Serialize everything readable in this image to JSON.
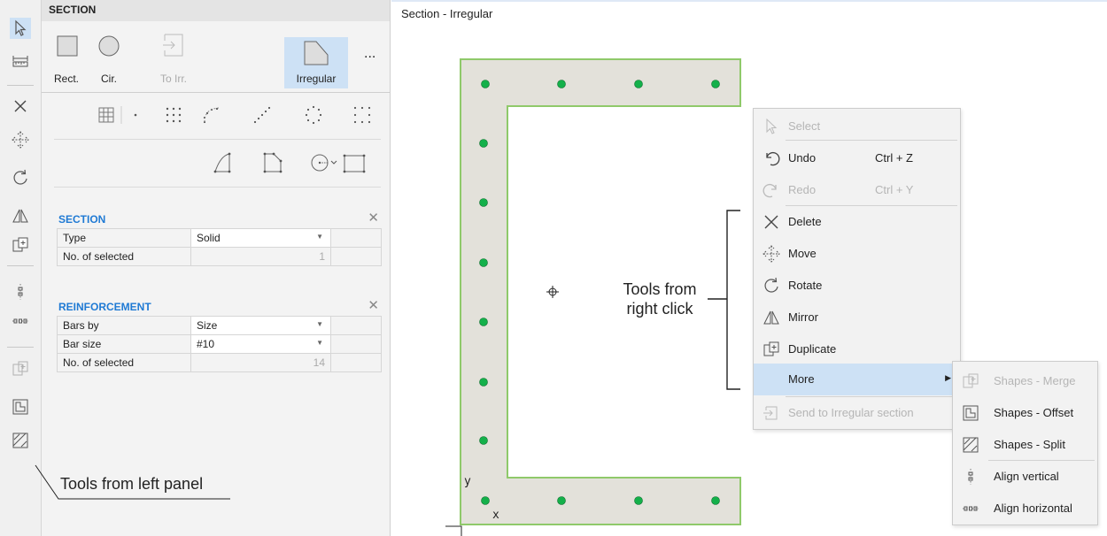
{
  "panel": {
    "title": "SECTION",
    "shape_buttons": [
      "Rect.",
      "Cir.",
      "To Irr.",
      "Irregular"
    ],
    "more_label": "...",
    "section": {
      "heading": "SECTION",
      "rows": [
        {
          "label": "Type",
          "value": "Solid"
        },
        {
          "label": "No. of selected",
          "value": "1"
        }
      ]
    },
    "reinforcement": {
      "heading": "REINFORCEMENT",
      "rows": [
        {
          "label": "Bars by",
          "value": "Size"
        },
        {
          "label": "Bar size",
          "value": "#10"
        },
        {
          "label": "No. of selected",
          "value": "14"
        }
      ]
    }
  },
  "canvas": {
    "title": "Section - Irregular",
    "axis_y": "y",
    "axis_x": "x"
  },
  "context_menu": {
    "items": [
      {
        "label": "Select",
        "shortcut": "",
        "icon": "cursor-icon"
      },
      {
        "label": "Undo",
        "shortcut": "Ctrl + Z",
        "icon": "undo-icon"
      },
      {
        "label": "Redo",
        "shortcut": "Ctrl + Y",
        "icon": "redo-icon"
      },
      {
        "label": "Delete",
        "shortcut": "",
        "icon": "delete-icon"
      },
      {
        "label": "Move",
        "shortcut": "",
        "icon": "move-icon"
      },
      {
        "label": "Rotate",
        "shortcut": "",
        "icon": "rotate-icon"
      },
      {
        "label": "Mirror",
        "shortcut": "",
        "icon": "mirror-icon"
      },
      {
        "label": "Duplicate",
        "shortcut": "",
        "icon": "duplicate-icon"
      },
      {
        "label": "More",
        "shortcut": "",
        "icon": ""
      },
      {
        "label": "Send to Irregular section",
        "shortcut": "",
        "icon": "send-to-irregular-icon"
      }
    ],
    "submenu": [
      {
        "label": "Shapes - Merge",
        "icon": "merge-icon"
      },
      {
        "label": "Shapes - Offset",
        "icon": "offset-icon"
      },
      {
        "label": "Shapes - Split",
        "icon": "split-icon"
      },
      {
        "label": "Align vertical",
        "icon": "align-vertical-icon"
      },
      {
        "label": "Align horizontal",
        "icon": "align-horizontal-icon"
      }
    ]
  },
  "annotations": {
    "left_panel": "Tools from left panel",
    "right_click_line1": "Tools from",
    "right_click_line2": "right click"
  },
  "colors": {
    "accent": "#1f7ad4",
    "selected_button": "#cde1f5",
    "section_fill": "#e3e1da",
    "section_outline": "#8fc96a",
    "rebar": "#14b04a",
    "menu_highlight": "#cde1f5"
  }
}
